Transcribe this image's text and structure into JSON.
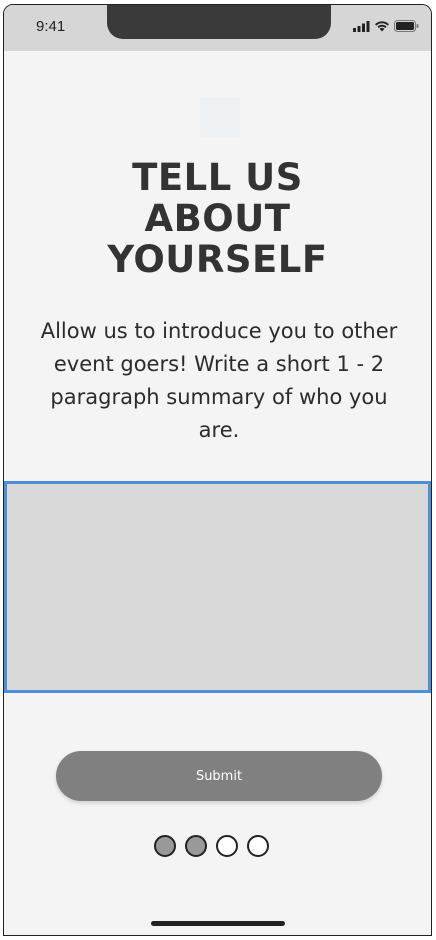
{
  "status_bar": {
    "time": "9:41",
    "icons": [
      "signal-icon",
      "wifi-icon",
      "battery-icon"
    ]
  },
  "header": {
    "title": "TELL US\nABOUT\nYOURSELF"
  },
  "main": {
    "description": "Allow us to introduce you to other event goers! Write a short 1 - 2 paragraph summary of who you are.",
    "summary_input": {
      "value": "",
      "placeholder": ""
    },
    "submit_label": "Submit"
  },
  "pager": {
    "total": 4,
    "current_step": 2
  },
  "colors": {
    "accent_border": "#4a90d9",
    "button_bg": "#808080",
    "input_bg": "#d9d9d9",
    "background": "#f4f4f4"
  }
}
